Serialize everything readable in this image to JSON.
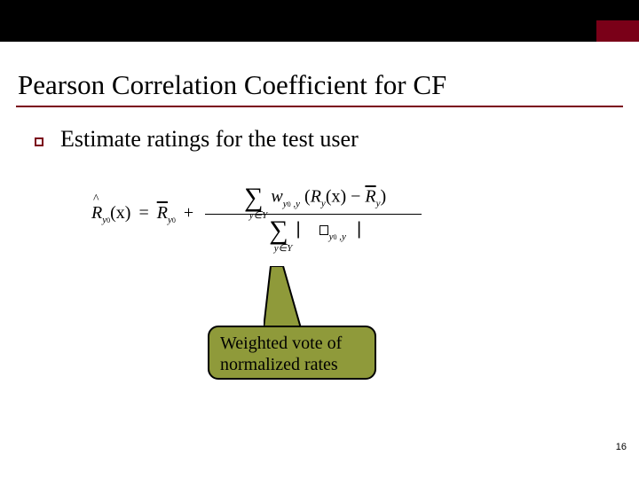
{
  "header": {
    "title": "Pearson Correlation Coefficient for CF"
  },
  "bullet": {
    "text": "Estimate ratings for the test user"
  },
  "formula": {
    "lhs_var": "R",
    "lhs_sub": "y",
    "lhs_sub0": "0",
    "lhs_arg": "(x)",
    "eq": "=",
    "rbar_var": "R",
    "rbar_sub": "y",
    "rbar_sub0": "0",
    "plus": "+",
    "sum_sym": "∑",
    "sum_below": "y∈Y",
    "w_var": "w",
    "w_sub_a": "y",
    "w_sub_a0": "0",
    "w_comma": " ,",
    "w_sub_b": "y",
    "lparen": "(",
    "Ry_var": "R",
    "Ry_sub": "y",
    "Ry_arg": "(x)",
    "minus": "−",
    "Rybar_var": "R",
    "Rybar_sub": "y",
    "rparen": ")",
    "pipe": "|"
  },
  "callout": {
    "line1": "Weighted vote of",
    "line2": "normalized rates"
  },
  "page_number": "16"
}
